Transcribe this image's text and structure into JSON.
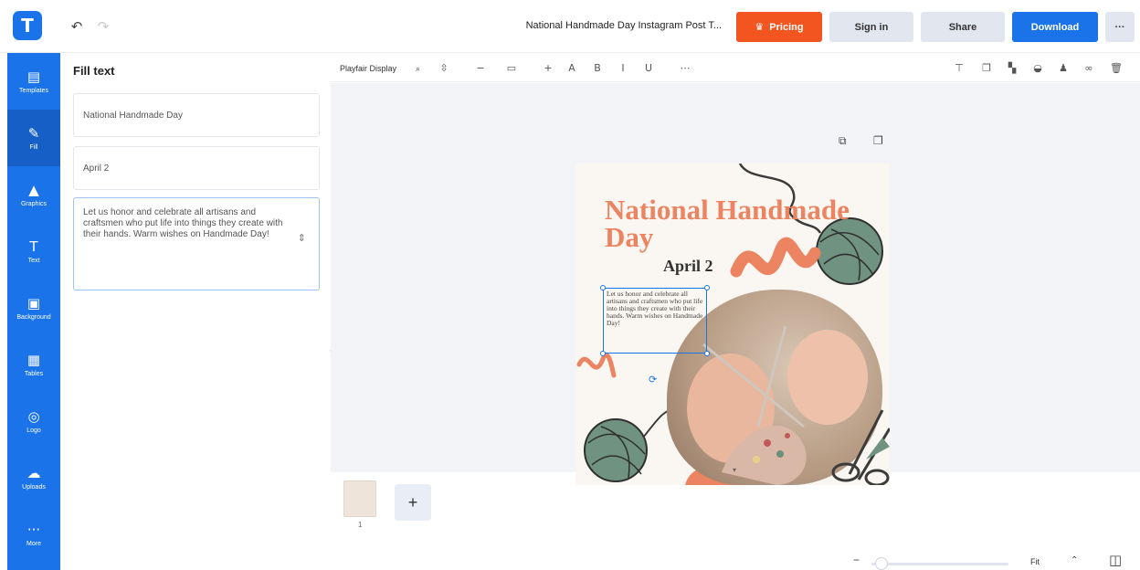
{
  "topbar": {
    "logo_letter": "T",
    "doc_title": "National Handmade Day Instagram Post T...",
    "pricing_label": "Pricing",
    "signin_label": "Sign in",
    "share_label": "Share",
    "download_label": "Download",
    "more_label": "···",
    "pricing_color": "#f2551f",
    "accent_color": "#1a73e8"
  },
  "nav": {
    "items": [
      {
        "label": "Templates",
        "icon": "templates-icon"
      },
      {
        "label": "Fill",
        "icon": "fill-pen-icon"
      },
      {
        "label": "Graphics",
        "icon": "graphics-icon"
      },
      {
        "label": "Text",
        "icon": "text-icon"
      },
      {
        "label": "Background",
        "icon": "background-icon"
      },
      {
        "label": "Tables",
        "icon": "tables-icon"
      },
      {
        "label": "Logo",
        "icon": "logo-icon"
      },
      {
        "label": "Uploads",
        "icon": "uploads-icon"
      },
      {
        "label": "More",
        "icon": "more-icon"
      }
    ]
  },
  "panel": {
    "title": "Fill text",
    "fields": [
      "National Handmade Day",
      "April 2",
      "Let us honor and celebrate all artisans and craftsmen who put life into things they create with their hands. Warm wishes on Handmade Day!"
    ]
  },
  "toolbar": {
    "font_name": "Playfair Display"
  },
  "design": {
    "headline": "National Handmade Day",
    "date": "April 2",
    "body": "Let us honor and celebrate all artisans and craftsmen who put life into things they create with their hands. Warm wishes on Handmade Day!"
  },
  "pages": {
    "thumb_number": "1",
    "add_label": "+"
  },
  "zoom": {
    "value_label": "Fit"
  }
}
